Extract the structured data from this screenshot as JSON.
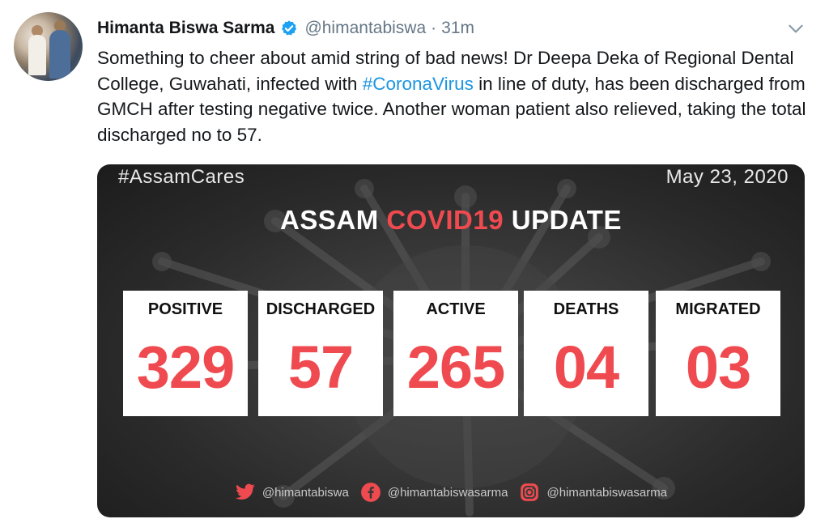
{
  "author": {
    "name": "Himanta Biswa Sarma",
    "handle": "@himantabiswa",
    "separator": "·",
    "time": "31m"
  },
  "tweet": {
    "text_before": "Something to cheer about amid string of bad news! Dr Deepa Deka of Regional Dental College, Guwahati, infected with ",
    "hashtag": "#CoronaVirus",
    "text_after": " in line of duty, has been discharged from GMCH after testing negative twice. Another woman patient also relieved, taking the total discharged no to 57."
  },
  "card": {
    "tag": "#AssamCares",
    "date": "May 23, 2020",
    "title_part1": "ASSAM ",
    "title_part2": "COVID19",
    "title_part3": " UPDATE",
    "stats": [
      {
        "label": "POSITIVE",
        "value": "329"
      },
      {
        "label": "DISCHARGED",
        "value": "57"
      },
      {
        "label": "ACTIVE",
        "value": "265"
      },
      {
        "label": "DEATHS",
        "value": "04"
      },
      {
        "label": "MIGRATED",
        "value": "03"
      }
    ],
    "social": {
      "twitter": "@himantabiswa",
      "facebook": "@himantabiswasarma",
      "instagram": "@himantabiswasarma"
    }
  },
  "icons": {
    "verified": "verified-badge-icon",
    "more": "chevron-down-icon",
    "twitter": "twitter-icon",
    "facebook": "facebook-icon",
    "instagram": "instagram-icon"
  },
  "colors": {
    "accent_red": "#ef4a4f",
    "link_blue": "#1b95e0",
    "verified_blue": "#1da1f2",
    "muted_gray": "#657786"
  }
}
